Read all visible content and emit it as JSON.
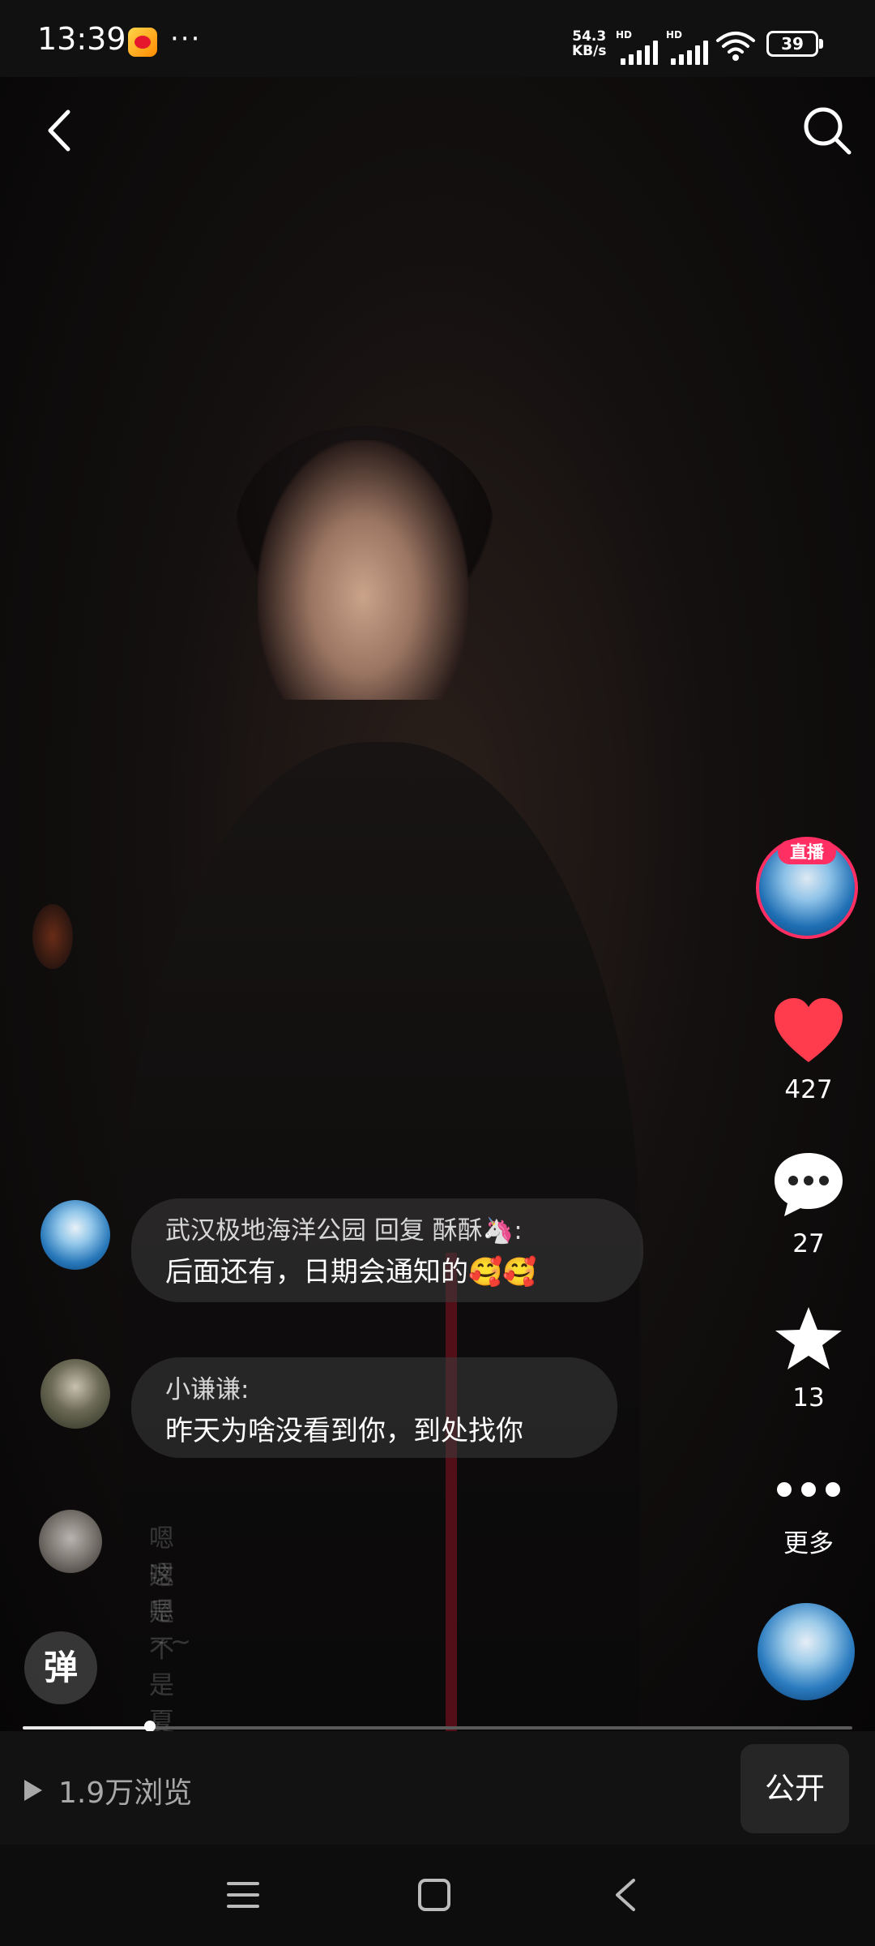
{
  "status_bar": {
    "time": "13:39",
    "more": "···",
    "net_speed_value": "54.3",
    "net_speed_unit": "KB/s",
    "sim1_label": "HD",
    "sim2_label": "HD",
    "battery": "39"
  },
  "header": {
    "back_icon": "chevron-left-icon",
    "search_icon": "search-icon"
  },
  "side_actions": {
    "live_badge": "直播",
    "like_count": "427",
    "comment_count": "27",
    "favorite_count": "13",
    "more_label": "更多"
  },
  "danmaku": [
    {
      "name": "武汉极地海洋公园 回复 酥酥🦄:",
      "text": "后面还有，日期会通知的🥰🥰"
    },
    {
      "name": "小谦谦:",
      "text": "昨天为啥没看到你，到处找你"
    },
    {
      "name": "嗯嗯嗯~~",
      "text": "这是不是夏天巡游的马"
    }
  ],
  "danmaku_toggle": "弹",
  "player": {
    "progress_fraction": 0.153
  },
  "bottom": {
    "views": "1.9万浏览",
    "public_button": "公开"
  },
  "colors": {
    "live_accent": "#ff2e63",
    "like_red": "#ff3b4e"
  }
}
